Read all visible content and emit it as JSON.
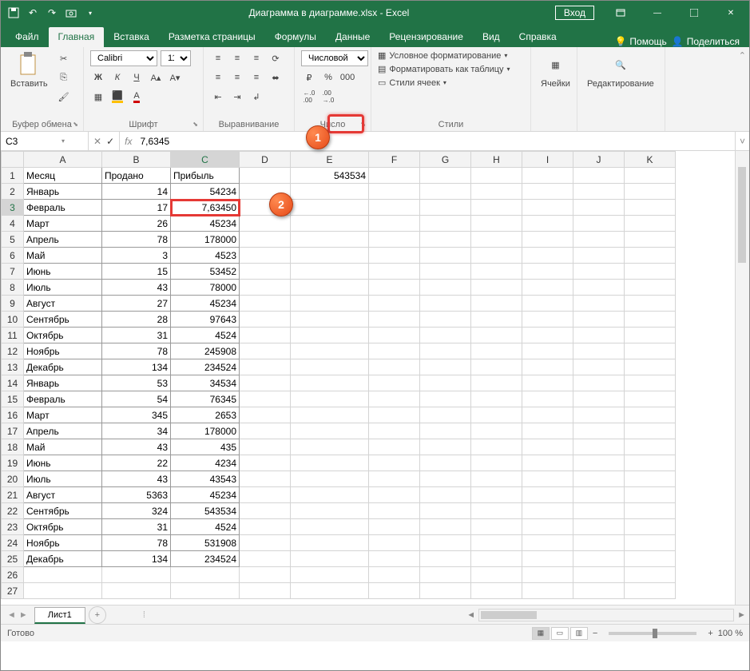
{
  "window": {
    "title": "Диаграмма в диаграмме.xlsx  -  Excel",
    "login": "Вход"
  },
  "tabs": {
    "file": "Файл",
    "home": "Главная",
    "insert": "Вставка",
    "layout": "Разметка страницы",
    "formulas": "Формулы",
    "data": "Данные",
    "review": "Рецензирование",
    "view": "Вид",
    "help": "Справка",
    "tellme": "Помощь",
    "share": "Поделиться"
  },
  "ribbon": {
    "clipboard": {
      "paste": "Вставить",
      "label": "Буфер обмена"
    },
    "font": {
      "name": "Calibri",
      "size": "11",
      "bold": "Ж",
      "italic": "К",
      "underline": "Ч",
      "label": "Шрифт"
    },
    "align": {
      "label": "Выравнивание"
    },
    "number": {
      "format": "Числовой",
      "label": "Число"
    },
    "styles": {
      "cond": "Условное форматирование",
      "table": "Форматировать как таблицу",
      "cell": "Стили ячеек",
      "label": "Стили"
    },
    "cells": {
      "label": "Ячейки"
    },
    "editing": {
      "label": "Редактирование"
    }
  },
  "formula_bar": {
    "cell_ref": "C3",
    "value": "7,6345"
  },
  "columns": [
    "A",
    "B",
    "C",
    "D",
    "E",
    "F",
    "G",
    "H",
    "I",
    "J",
    "K"
  ],
  "headers": {
    "A": "Месяц",
    "B": "Продано",
    "C": "Прибыль",
    "E": "543534"
  },
  "rows": [
    {
      "n": 1
    },
    {
      "n": 2,
      "A": "Январь",
      "B": "14",
      "C": "54234"
    },
    {
      "n": 3,
      "A": "Февраль",
      "B": "17",
      "C": "7,63450"
    },
    {
      "n": 4,
      "A": "Март",
      "B": "26",
      "C": "45234"
    },
    {
      "n": 5,
      "A": "Апрель",
      "B": "78",
      "C": "178000"
    },
    {
      "n": 6,
      "A": "Май",
      "B": "3",
      "C": "4523"
    },
    {
      "n": 7,
      "A": "Июнь",
      "B": "15",
      "C": "53452"
    },
    {
      "n": 8,
      "A": "Июль",
      "B": "43",
      "C": "78000"
    },
    {
      "n": 9,
      "A": "Август",
      "B": "27",
      "C": "45234"
    },
    {
      "n": 10,
      "A": "Сентябрь",
      "B": "28",
      "C": "97643"
    },
    {
      "n": 11,
      "A": "Октябрь",
      "B": "31",
      "C": "4524"
    },
    {
      "n": 12,
      "A": "Ноябрь",
      "B": "78",
      "C": "245908"
    },
    {
      "n": 13,
      "A": "Декабрь",
      "B": "134",
      "C": "234524"
    },
    {
      "n": 14,
      "A": "Январь",
      "B": "53",
      "C": "34534"
    },
    {
      "n": 15,
      "A": "Февраль",
      "B": "54",
      "C": "76345"
    },
    {
      "n": 16,
      "A": "Март",
      "B": "345",
      "C": "2653"
    },
    {
      "n": 17,
      "A": "Апрель",
      "B": "34",
      "C": "178000"
    },
    {
      "n": 18,
      "A": "Май",
      "B": "43",
      "C": "435"
    },
    {
      "n": 19,
      "A": "Июнь",
      "B": "22",
      "C": "4234"
    },
    {
      "n": 20,
      "A": "Июль",
      "B": "43",
      "C": "43543"
    },
    {
      "n": 21,
      "A": "Август",
      "B": "5363",
      "C": "45234"
    },
    {
      "n": 22,
      "A": "Сентябрь",
      "B": "324",
      "C": "543534"
    },
    {
      "n": 23,
      "A": "Октябрь",
      "B": "31",
      "C": "4524"
    },
    {
      "n": 24,
      "A": "Ноябрь",
      "B": "78",
      "C": "531908"
    },
    {
      "n": 25,
      "A": "Декабрь",
      "B": "134",
      "C": "234524"
    }
  ],
  "sheet": {
    "name": "Лист1"
  },
  "status": {
    "ready": "Готово",
    "zoom": "100 %"
  },
  "callouts": {
    "one": "1",
    "two": "2"
  },
  "col_widths": {
    "rowhdr": 28,
    "A": 98,
    "B": 86,
    "C": 86,
    "D": 64,
    "E": 98,
    "F": 64,
    "G": 64,
    "H": 64,
    "I": 64,
    "J": 64,
    "K": 64
  },
  "selected": {
    "row": 3,
    "col": "C"
  }
}
